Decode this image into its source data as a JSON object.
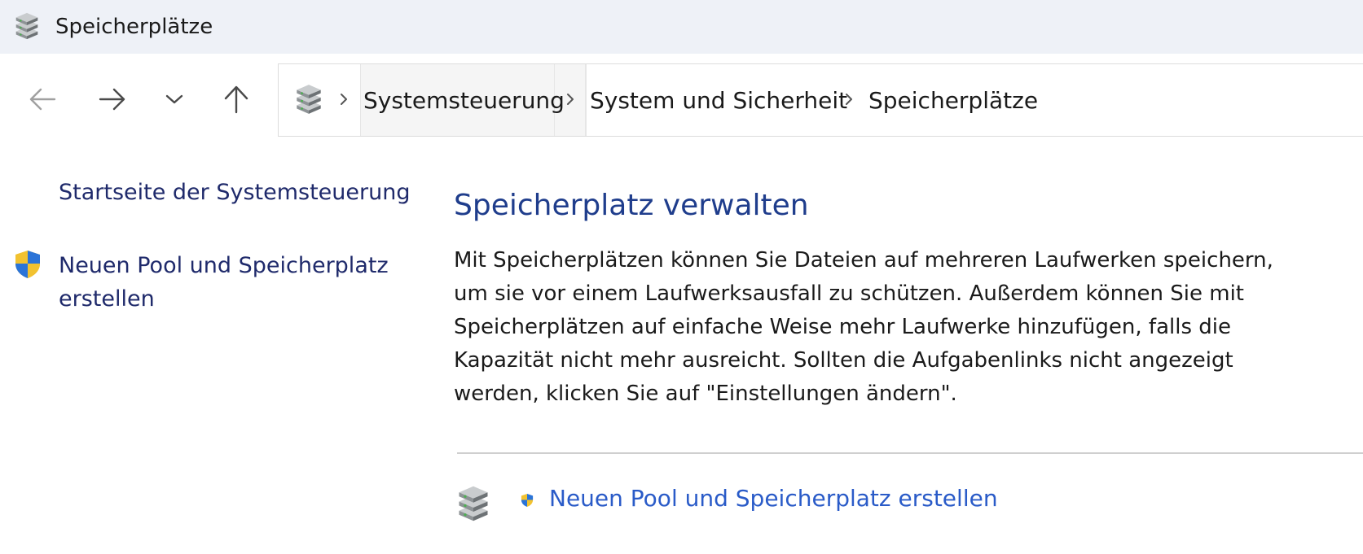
{
  "window": {
    "title": "Speicherplätze",
    "app_icon": "storage-spaces-icon"
  },
  "navigation": {
    "back_icon": "arrow-left-icon",
    "forward_icon": "arrow-right-icon",
    "recent_icon": "chevron-down-icon",
    "up_icon": "arrow-up-icon"
  },
  "breadcrumb": {
    "root_icon": "storage-spaces-icon",
    "items": [
      {
        "label": "Systemsteuerung"
      },
      {
        "label": "System und Sicherheit"
      },
      {
        "label": "Speicherplätze"
      }
    ]
  },
  "sidebar": {
    "items": [
      {
        "label": "Startseite der Systemsteuerung",
        "icon": ""
      },
      {
        "label": "Neuen Pool und Speicherplatz erstellen",
        "icon": "uac-shield-icon"
      }
    ]
  },
  "main": {
    "heading": "Speicherplatz verwalten",
    "description": "Mit Speicherplätzen können Sie Dateien auf mehreren Laufwerken speichern, um sie vor einem Laufwerksausfall zu schützen. Außerdem können Sie mit Speicherplätzen auf einfache Weise mehr Laufwerke hinzufügen, falls die Kapazität nicht mehr ausreicht. Sollten die Aufgabenlinks nicht angezeigt werden, klicken Sie auf \"Einstellungen ändern\".",
    "task": {
      "label": "Neuen Pool und Speicherplatz erstellen",
      "icon": "storage-spaces-icon",
      "shield_icon": "uac-shield-icon"
    }
  },
  "colors": {
    "title_bar_bg": "#eef1f7",
    "sidebar_link": "#1f2a6b",
    "heading": "#1f3d8c",
    "task_link": "#2a5bc8"
  }
}
